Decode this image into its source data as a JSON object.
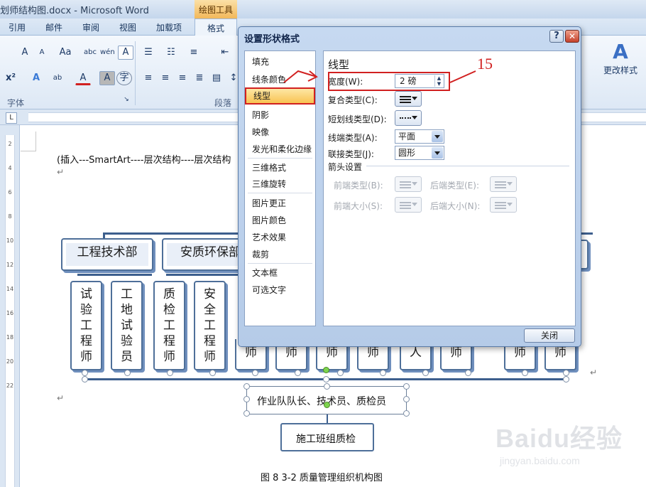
{
  "window": {
    "title": "划师结构图.docx - Microsoft Word",
    "contextual_tab_group": "绘图工具"
  },
  "ribbon_tabs": [
    "引用",
    "邮件",
    "审阅",
    "视图",
    "加载项",
    "格式"
  ],
  "ribbon": {
    "font_group_label": "字体",
    "paragraph_group_label": "段落",
    "font_buttons": [
      "A",
      "A",
      "Aa",
      "abc",
      "wén",
      "A",
      "x²",
      "A",
      "ab",
      "A",
      "A",
      "字"
    ],
    "change_styles_label": "更改样式"
  },
  "document": {
    "intro_line": "(插入---SmartArt----层次结构----层次结构",
    "caption": "图 8 3-2 质量管理组织机构图",
    "org_chart": {
      "departments": [
        "工程技术部",
        "安质环保部"
      ],
      "roles": [
        "试验工程师",
        "工地试验员",
        "质检工程师",
        "安全工程师"
      ],
      "partial_roles": [
        "师",
        "师",
        "师",
        "师",
        "人",
        "师",
        "师",
        "师"
      ],
      "team_box": "作业队队长、技术员、质检员",
      "group_box": "施工班组质检"
    }
  },
  "dialog": {
    "title": "设置形状格式",
    "help_label": "?",
    "close_x_label": "✕",
    "nav_items": [
      "填充",
      "线条颜色",
      "线型",
      "阴影",
      "映像",
      "发光和柔化边缘",
      "三维格式",
      "三维旋转",
      "图片更正",
      "图片颜色",
      "艺术效果",
      "裁剪",
      "文本框",
      "可选文字"
    ],
    "selected_nav": "线型",
    "panel_title": "线型",
    "fields": {
      "width_label": "宽度(W):",
      "width_value": "2 磅",
      "compound_label": "复合类型(C):",
      "dash_label": "短划线类型(D):",
      "cap_label": "线端类型(A):",
      "cap_value": "平面",
      "join_label": "联接类型(J):",
      "join_value": "圆形",
      "arrow_section": "箭头设置",
      "begin_type_label": "前端类型(B):",
      "end_type_label": "后端类型(E):",
      "begin_size_label": "前端大小(S):",
      "end_size_label": "后端大小(N):"
    },
    "close_button": "关闭"
  },
  "annotation": {
    "number": "15",
    "color": "#d12020"
  },
  "watermark": {
    "brand": "Baidu经验",
    "sub": "jingyan.baidu.com"
  }
}
